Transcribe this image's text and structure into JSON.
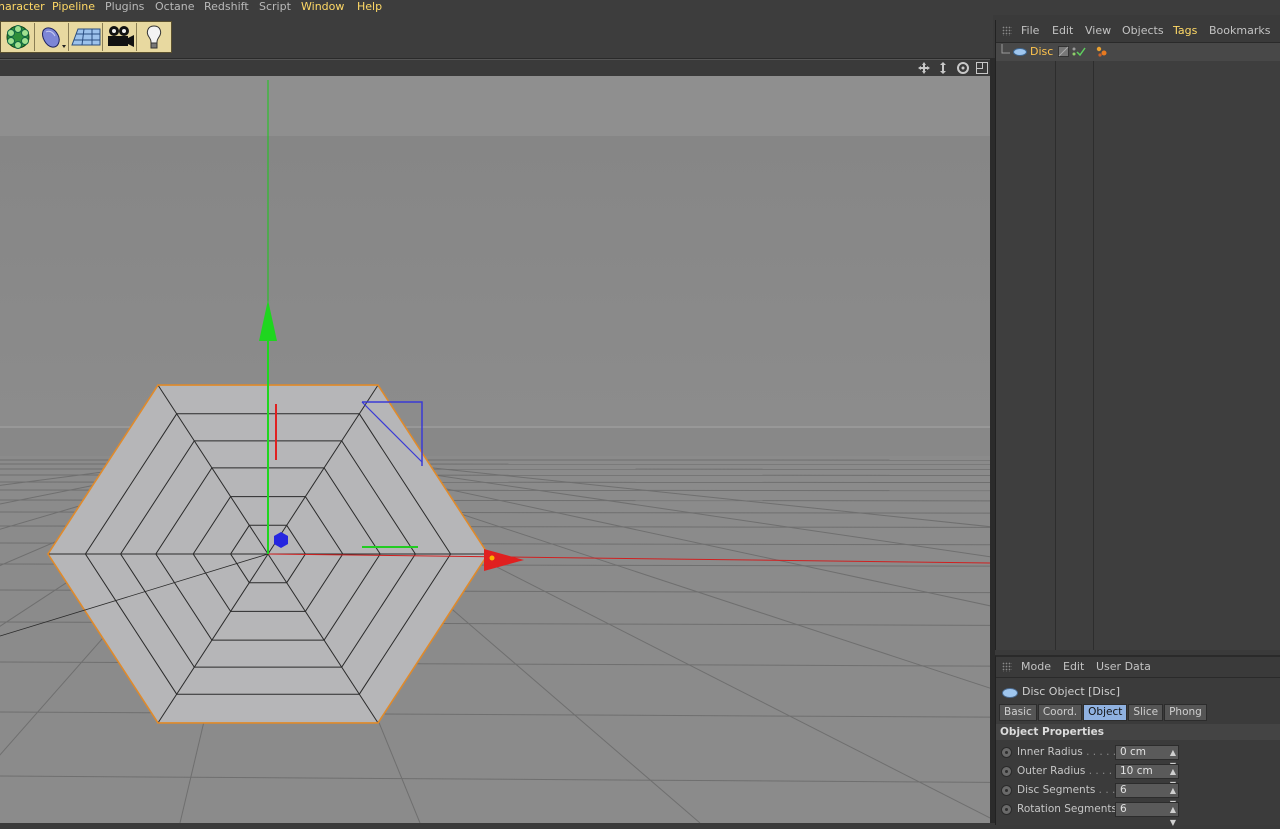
{
  "menu": [
    "haracter",
    "Pipeline",
    "Plugins",
    "Octane",
    "Redshift",
    "Script",
    "Window",
    "Help"
  ],
  "toolbar": {
    "icons": [
      "cloner-icon",
      "deformer-icon",
      "floor-icon",
      "camera-icon",
      "light-icon"
    ]
  },
  "viewport": {
    "nav_icons": [
      "move-view-icon",
      "zoom-view-icon",
      "rotate-view-icon",
      "maximize-view-icon"
    ]
  },
  "object_manager": {
    "menu": [
      "File",
      "Edit",
      "View",
      "Objects",
      "Tags",
      "Bookmarks"
    ],
    "object": {
      "name": "Disc",
      "icon": "disc-icon"
    }
  },
  "attribute_manager": {
    "menu": [
      "Mode",
      "Edit",
      "User Data"
    ],
    "title": "Disc Object [Disc]",
    "tabs": [
      "Basic",
      "Coord.",
      "Object",
      "Slice",
      "Phong"
    ],
    "active_tab": "Object",
    "section": "Object Properties",
    "params": [
      {
        "label": "Inner Radius",
        "dots": " . . . . .",
        "value": "0 cm"
      },
      {
        "label": "Outer Radius",
        "dots": " . . . .",
        "value": "10 cm"
      },
      {
        "label": "Disc Segments",
        "dots": " . . .",
        "value": "6"
      },
      {
        "label": "Rotation Segments",
        "dots": "",
        "value": "6"
      }
    ]
  },
  "colors": {
    "selection": "#e08a2a",
    "axis_x": "#e02020",
    "axis_y": "#19d019",
    "axis_z": "#2222dd",
    "viewport_bg": "#888888"
  }
}
